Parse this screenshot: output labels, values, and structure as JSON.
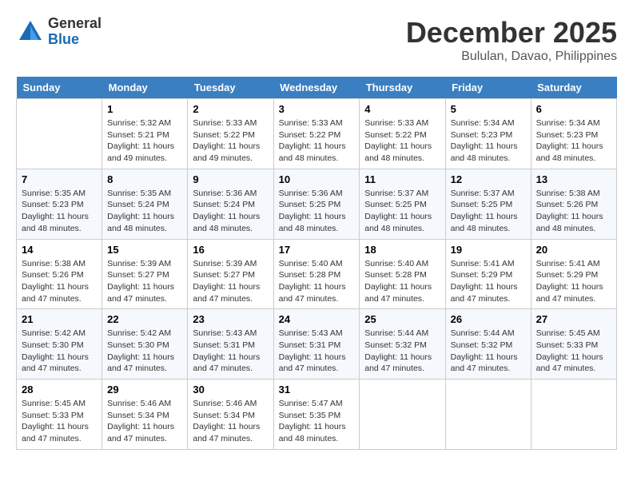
{
  "header": {
    "logo_general": "General",
    "logo_blue": "Blue",
    "month": "December 2025",
    "location": "Bululan, Davao, Philippines"
  },
  "days_of_week": [
    "Sunday",
    "Monday",
    "Tuesday",
    "Wednesday",
    "Thursday",
    "Friday",
    "Saturday"
  ],
  "weeks": [
    [
      {
        "day": "",
        "info": ""
      },
      {
        "day": "1",
        "info": "Sunrise: 5:32 AM\nSunset: 5:21 PM\nDaylight: 11 hours\nand 49 minutes."
      },
      {
        "day": "2",
        "info": "Sunrise: 5:33 AM\nSunset: 5:22 PM\nDaylight: 11 hours\nand 49 minutes."
      },
      {
        "day": "3",
        "info": "Sunrise: 5:33 AM\nSunset: 5:22 PM\nDaylight: 11 hours\nand 48 minutes."
      },
      {
        "day": "4",
        "info": "Sunrise: 5:33 AM\nSunset: 5:22 PM\nDaylight: 11 hours\nand 48 minutes."
      },
      {
        "day": "5",
        "info": "Sunrise: 5:34 AM\nSunset: 5:23 PM\nDaylight: 11 hours\nand 48 minutes."
      },
      {
        "day": "6",
        "info": "Sunrise: 5:34 AM\nSunset: 5:23 PM\nDaylight: 11 hours\nand 48 minutes."
      }
    ],
    [
      {
        "day": "7",
        "info": "Sunrise: 5:35 AM\nSunset: 5:23 PM\nDaylight: 11 hours\nand 48 minutes."
      },
      {
        "day": "8",
        "info": "Sunrise: 5:35 AM\nSunset: 5:24 PM\nDaylight: 11 hours\nand 48 minutes."
      },
      {
        "day": "9",
        "info": "Sunrise: 5:36 AM\nSunset: 5:24 PM\nDaylight: 11 hours\nand 48 minutes."
      },
      {
        "day": "10",
        "info": "Sunrise: 5:36 AM\nSunset: 5:25 PM\nDaylight: 11 hours\nand 48 minutes."
      },
      {
        "day": "11",
        "info": "Sunrise: 5:37 AM\nSunset: 5:25 PM\nDaylight: 11 hours\nand 48 minutes."
      },
      {
        "day": "12",
        "info": "Sunrise: 5:37 AM\nSunset: 5:25 PM\nDaylight: 11 hours\nand 48 minutes."
      },
      {
        "day": "13",
        "info": "Sunrise: 5:38 AM\nSunset: 5:26 PM\nDaylight: 11 hours\nand 48 minutes."
      }
    ],
    [
      {
        "day": "14",
        "info": "Sunrise: 5:38 AM\nSunset: 5:26 PM\nDaylight: 11 hours\nand 47 minutes."
      },
      {
        "day": "15",
        "info": "Sunrise: 5:39 AM\nSunset: 5:27 PM\nDaylight: 11 hours\nand 47 minutes."
      },
      {
        "day": "16",
        "info": "Sunrise: 5:39 AM\nSunset: 5:27 PM\nDaylight: 11 hours\nand 47 minutes."
      },
      {
        "day": "17",
        "info": "Sunrise: 5:40 AM\nSunset: 5:28 PM\nDaylight: 11 hours\nand 47 minutes."
      },
      {
        "day": "18",
        "info": "Sunrise: 5:40 AM\nSunset: 5:28 PM\nDaylight: 11 hours\nand 47 minutes."
      },
      {
        "day": "19",
        "info": "Sunrise: 5:41 AM\nSunset: 5:29 PM\nDaylight: 11 hours\nand 47 minutes."
      },
      {
        "day": "20",
        "info": "Sunrise: 5:41 AM\nSunset: 5:29 PM\nDaylight: 11 hours\nand 47 minutes."
      }
    ],
    [
      {
        "day": "21",
        "info": "Sunrise: 5:42 AM\nSunset: 5:30 PM\nDaylight: 11 hours\nand 47 minutes."
      },
      {
        "day": "22",
        "info": "Sunrise: 5:42 AM\nSunset: 5:30 PM\nDaylight: 11 hours\nand 47 minutes."
      },
      {
        "day": "23",
        "info": "Sunrise: 5:43 AM\nSunset: 5:31 PM\nDaylight: 11 hours\nand 47 minutes."
      },
      {
        "day": "24",
        "info": "Sunrise: 5:43 AM\nSunset: 5:31 PM\nDaylight: 11 hours\nand 47 minutes."
      },
      {
        "day": "25",
        "info": "Sunrise: 5:44 AM\nSunset: 5:32 PM\nDaylight: 11 hours\nand 47 minutes."
      },
      {
        "day": "26",
        "info": "Sunrise: 5:44 AM\nSunset: 5:32 PM\nDaylight: 11 hours\nand 47 minutes."
      },
      {
        "day": "27",
        "info": "Sunrise: 5:45 AM\nSunset: 5:33 PM\nDaylight: 11 hours\nand 47 minutes."
      }
    ],
    [
      {
        "day": "28",
        "info": "Sunrise: 5:45 AM\nSunset: 5:33 PM\nDaylight: 11 hours\nand 47 minutes."
      },
      {
        "day": "29",
        "info": "Sunrise: 5:46 AM\nSunset: 5:34 PM\nDaylight: 11 hours\nand 47 minutes."
      },
      {
        "day": "30",
        "info": "Sunrise: 5:46 AM\nSunset: 5:34 PM\nDaylight: 11 hours\nand 47 minutes."
      },
      {
        "day": "31",
        "info": "Sunrise: 5:47 AM\nSunset: 5:35 PM\nDaylight: 11 hours\nand 48 minutes."
      },
      {
        "day": "",
        "info": ""
      },
      {
        "day": "",
        "info": ""
      },
      {
        "day": "",
        "info": ""
      }
    ]
  ]
}
